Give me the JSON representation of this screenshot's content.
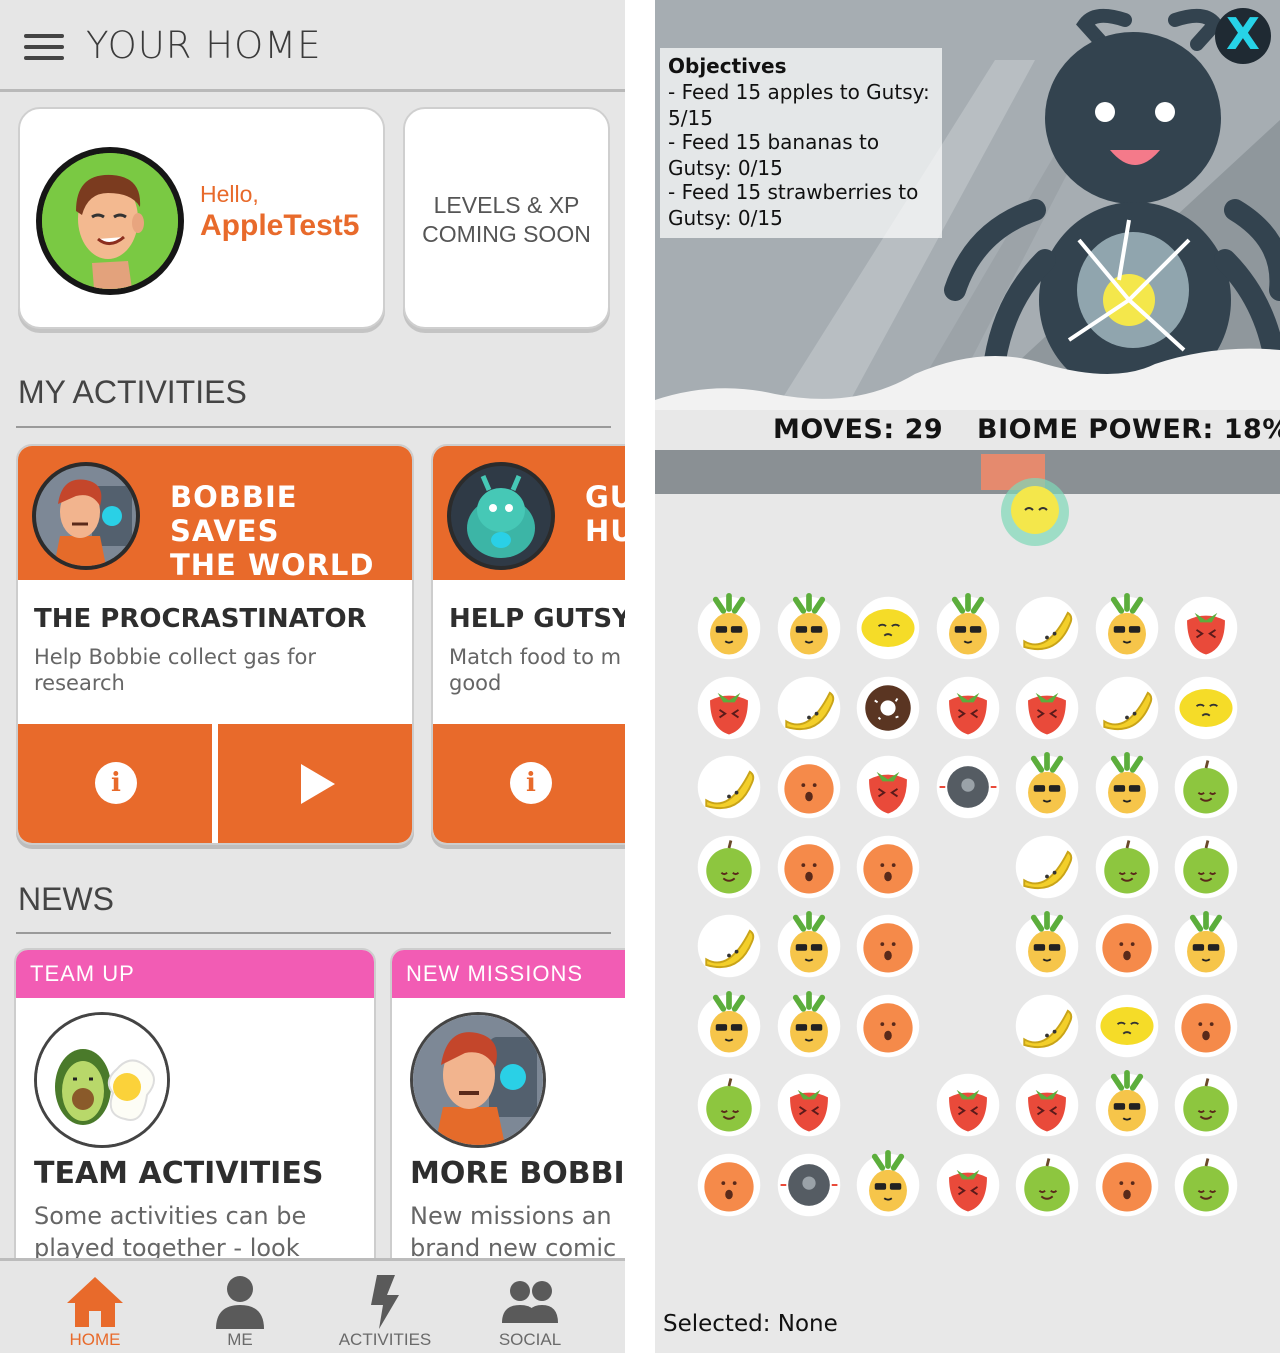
{
  "home": {
    "header_title": "YOUR HOME",
    "profile": {
      "greeting": "Hello,",
      "username": "AppleTest5"
    },
    "levels_card": {
      "line1": "LEVELS & XP",
      "line2": "COMING SOON"
    },
    "my_activities_title": "MY ACTIVITIES",
    "activities": [
      {
        "header": "BOBBIE SAVES\nTHE WORLD",
        "name": "THE PROCRASTINATOR",
        "desc_line1": "Help Bobbie collect gas for",
        "desc_line2": "research"
      },
      {
        "header": "GU\nHU",
        "name": "HELP GUTSY",
        "desc_line1": "Match food to m",
        "desc_line2": "good"
      }
    ],
    "news_title": "NEWS",
    "news": [
      {
        "tag": "TEAM UP",
        "title": "TEAM ACTIVITIES",
        "desc_line1": "Some activities can be",
        "desc_line2": "played together - look"
      },
      {
        "tag": "NEW MISSIONS",
        "title": "MORE BOBBI",
        "desc_line1": "New missions an",
        "desc_line2": "brand new comic"
      }
    ],
    "nav": [
      {
        "label": "HOME",
        "icon": "house-icon",
        "active": true
      },
      {
        "label": "ME",
        "icon": "person-icon",
        "active": false
      },
      {
        "label": "ACTIVITIES",
        "icon": "lightning-icon",
        "active": false
      },
      {
        "label": "SOCIAL",
        "icon": "people-icon",
        "active": false
      }
    ],
    "colors": {
      "accent": "#e86a2b",
      "news_tag": "#f25cb4",
      "avatar_bg": "#7ac943"
    }
  },
  "game": {
    "close_label": "X",
    "objectives": {
      "heading": "Objectives",
      "lines": [
        "- Feed 15 apples to Gutsy:",
        "5/15",
        "- Feed 15 bananas to",
        "Gutsy: 0/15",
        "- Feed 15 strawberries to",
        "Gutsy: 0/15"
      ]
    },
    "moves": "MOVES: 29",
    "biome_power": "BIOME POWER: 18%",
    "selected": "Selected: None",
    "board": [
      [
        "pineapple",
        "pineapple",
        "lemon",
        "pineapple",
        "banana",
        "pineapple",
        "strawberry"
      ],
      [
        "strawberry",
        "banana",
        "donut",
        "strawberry",
        "strawberry",
        "banana",
        "lemon"
      ],
      [
        "banana",
        "orange",
        "strawberry",
        "robot",
        "pineapple",
        "pineapple",
        "apple"
      ],
      [
        "apple",
        "orange",
        "orange",
        "empty",
        "banana",
        "apple",
        "apple"
      ],
      [
        "banana",
        "pineapple",
        "orange",
        "empty",
        "pineapple",
        "orange",
        "pineapple"
      ],
      [
        "pineapple",
        "pineapple",
        "orange",
        "empty",
        "banana",
        "lemon",
        "orange"
      ],
      [
        "apple",
        "strawberry",
        "empty",
        "strawberry",
        "strawberry",
        "pineapple",
        "apple"
      ],
      [
        "orange",
        "robot",
        "pineapple",
        "strawberry",
        "apple",
        "orange",
        "apple"
      ]
    ]
  }
}
